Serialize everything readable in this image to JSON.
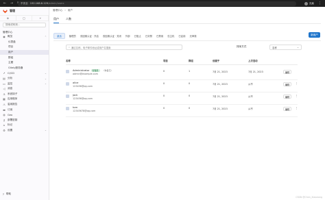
{
  "browser": {
    "warning": "不安全",
    "host": "192.168.8.129",
    "path": "/admin/users",
    "profile": "无痕"
  },
  "sidebar": {
    "brand": "管理",
    "search": "搜索或转到...",
    "section": "管理中心",
    "items": [
      {
        "label": "概览",
        "icon": "eye-icon",
        "chevron": "⌃"
      },
      {
        "label": "仪表盘",
        "sub": true
      },
      {
        "label": "项目",
        "sub": true
      },
      {
        "label": "用户",
        "sub": true,
        "active": true
      },
      {
        "label": "群组",
        "sub": true
      },
      {
        "label": "主题",
        "sub": true
      },
      {
        "label": "Gitaly服务器",
        "sub": true
      },
      {
        "label": "CI/CD",
        "icon": "rocket-icon",
        "chevron": "⌄"
      },
      {
        "label": "分析",
        "icon": "chart-icon",
        "chevron": "⌄"
      },
      {
        "label": "监控",
        "icon": "monitor-icon",
        "chevron": "⌄"
      },
      {
        "label": "消息",
        "icon": "bullhorn-icon"
      },
      {
        "label": "系统钩子",
        "icon": "hook-icon"
      },
      {
        "label": "应用程序",
        "icon": "apps-icon"
      },
      {
        "label": "滥用报告",
        "icon": "warning-icon"
      },
      {
        "label": "订阅",
        "icon": "card-icon"
      },
      {
        "label": "Geo",
        "icon": "globe-icon"
      },
      {
        "label": "部署密钥",
        "icon": "key-icon"
      },
      {
        "label": "标记",
        "icon": "label-icon"
      },
      {
        "label": "设置",
        "icon": "settings-icon",
        "chevron": "⌄"
      }
    ],
    "footer": "帮助"
  },
  "main": {
    "breadcrumb": [
      "管理中心",
      "用户"
    ],
    "tabs": [
      "用户",
      "人数"
    ],
    "filters": [
      "激活",
      "管理员",
      "双因素认证 · 开启",
      "双因素认证 · 关闭",
      "外部",
      "已阻止",
      "已封禁",
      "已禁用",
      "仅主机",
      "已启用",
      "无审核"
    ],
    "new_user": "新用户",
    "search_placeholder": "通过名称、电子邮件地址或用户名搜索",
    "sort_label": "排序方式",
    "sort_value": "名称",
    "columns": [
      "名称",
      "项目",
      "群组",
      "创建于",
      "上次活动"
    ],
    "users": [
      {
        "name": "Administrator",
        "admin_badge": "管理员",
        "me_badge": "（你自己）",
        "email": "admin@example.com",
        "projects": "0",
        "groups": "1",
        "created": "7月 21, 2023",
        "last_active": "7月 21, 2023",
        "edit": "编辑"
      },
      {
        "name": "alice",
        "email": "123456@qq.com",
        "projects": "0",
        "groups": "0",
        "created": "7月 21, 2023",
        "last_active": "从不",
        "edit": "编辑"
      },
      {
        "name": "jack",
        "email": "123456@qq.com",
        "projects": "0",
        "groups": "0",
        "created": "7月 21, 2023",
        "last_active": "从不",
        "edit": "编辑"
      },
      {
        "name": "tom",
        "email": "12345678@qq.com",
        "projects": "0",
        "groups": "0",
        "created": "7月 21, 2023",
        "last_active": "从不",
        "edit": "编辑"
      }
    ],
    "watermark": "CSDN @Chen_Xiaoxiong"
  },
  "colors": {
    "accent": "#1f75cb",
    "sidebar_bg": "#fbfafd",
    "browser_bar": "#1f1f1f"
  }
}
